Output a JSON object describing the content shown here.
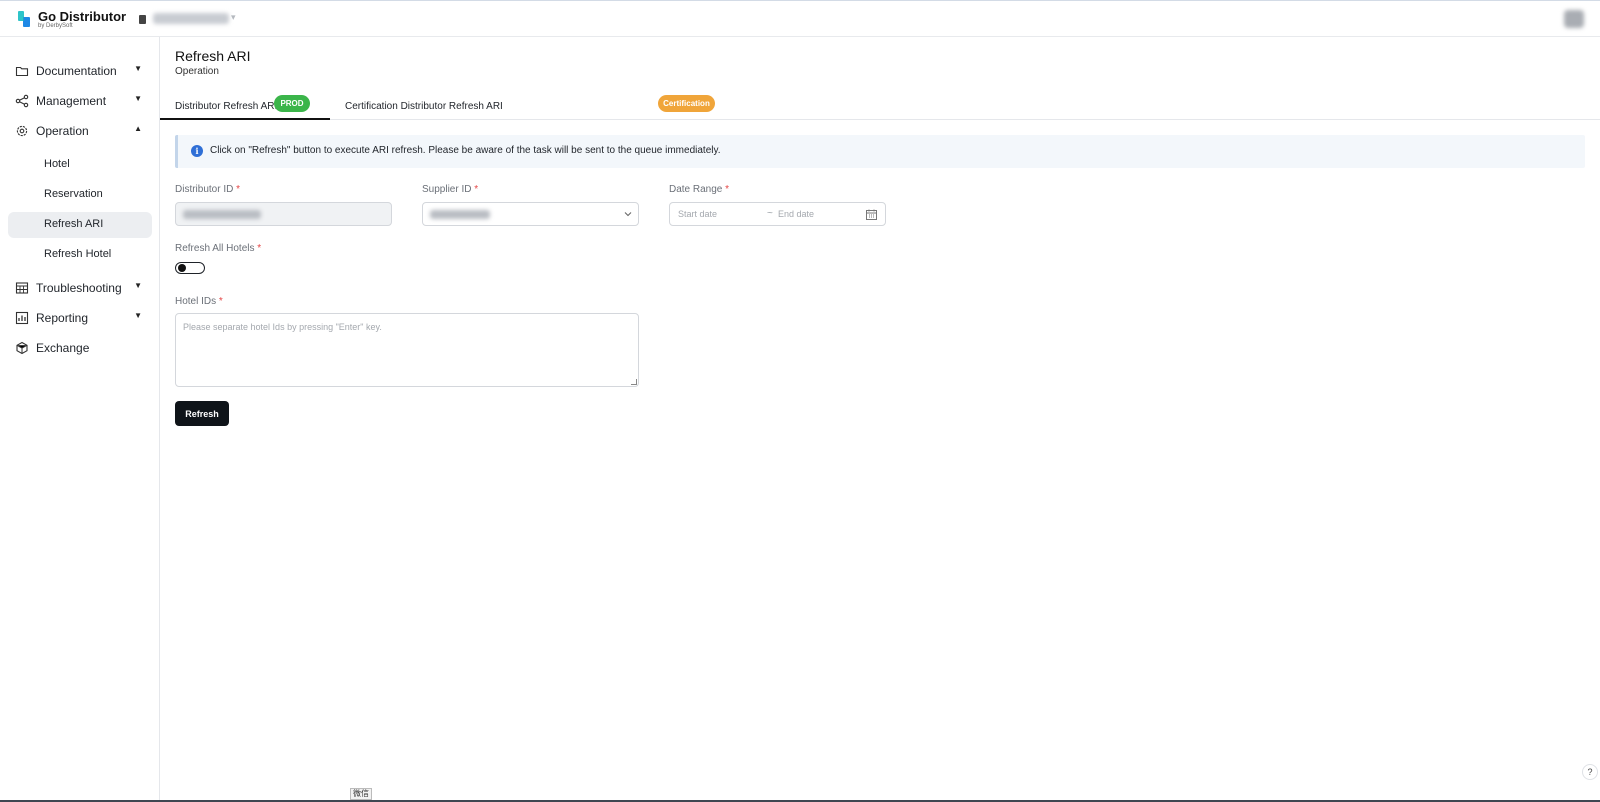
{
  "app": {
    "brand": "Go Distributor",
    "brand_sub": "by DerbySoft",
    "colors": {
      "prod_badge": "#3bb54a",
      "cert_badge": "#f0a53a",
      "primary_button": "#0f1419",
      "info_icon": "#2f6fd6",
      "active_nav_bg": "#eceef1"
    }
  },
  "sidebar": {
    "items": [
      {
        "label": "Documentation",
        "icon": "folder-icon",
        "expanded": false
      },
      {
        "label": "Management",
        "icon": "share-nodes-icon",
        "expanded": false
      },
      {
        "label": "Operation",
        "icon": "gear-icon",
        "expanded": true
      },
      {
        "label": "Troubleshooting",
        "icon": "calendar-grid-icon",
        "expanded": false
      },
      {
        "label": "Reporting",
        "icon": "report-chart-icon",
        "expanded": false
      },
      {
        "label": "Exchange",
        "icon": "cube-icon"
      }
    ],
    "operation_children": [
      {
        "label": "Hotel"
      },
      {
        "label": "Reservation"
      },
      {
        "label": "Refresh ARI",
        "active": true
      },
      {
        "label": "Refresh Hotel"
      }
    ]
  },
  "page": {
    "title": "Refresh ARI",
    "subtitle": "Operation"
  },
  "tabs": [
    {
      "label": "Distributor Refresh ARI",
      "badge": "PROD",
      "active": true
    },
    {
      "label": "Certification Distributor Refresh ARI",
      "badge": "Certification",
      "active": false
    }
  ],
  "alert": {
    "message": "Click on \"Refresh\" button to execute ARI refresh. Please be aware of the task will be sent to the queue immediately."
  },
  "form": {
    "distributor_id_label": "Distributor ID",
    "supplier_id_label": "Supplier ID",
    "date_range_label": "Date Range",
    "start_date_placeholder": "Start date",
    "date_separator": "~",
    "end_date_placeholder": "End date",
    "refresh_all_label": "Refresh All Hotels",
    "refresh_all_on": false,
    "hotel_ids_label": "Hotel IDs",
    "hotel_ids_placeholder": "Please separate hotel Ids by pressing \"Enter\" key.",
    "required_mark": "*",
    "submit_label": "Refresh"
  },
  "footer": {
    "help_glyph": "?",
    "ime_label": "微信"
  }
}
